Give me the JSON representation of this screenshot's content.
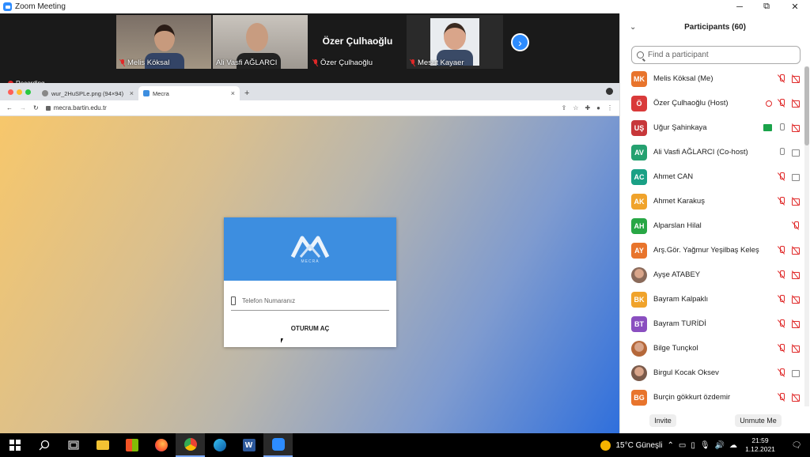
{
  "window": {
    "title": "Zoom Meeting",
    "minimize": "─",
    "restore": "⧉",
    "close": "✕"
  },
  "video_tiles": [
    {
      "name": "Melis Köksal",
      "type": "video",
      "muted": true
    },
    {
      "name": "Ali Vasfi AĞLARCI",
      "type": "video",
      "muted": false
    },
    {
      "name": "Özer Çulhaoğlu",
      "type": "name-only",
      "muted": true,
      "center_name": "Özer Çulhaoğlu"
    },
    {
      "name": "Mesut Kayaer",
      "type": "video",
      "muted": true
    }
  ],
  "next_tiles_icon": "chevron-right-icon",
  "recording": {
    "label": "Recording"
  },
  "browser": {
    "tabs": [
      {
        "label": "wur_2HuSPLe.png (94×94)",
        "active": false
      },
      {
        "label": "Mecra",
        "active": true
      }
    ],
    "new_tab": "+",
    "url": "mecra.bartin.edu.tr",
    "nav": {
      "back": "←",
      "forward": "→",
      "reload": "↻"
    }
  },
  "login": {
    "logo_sub": "MECRA",
    "phone_placeholder": "Telefon Numaranız",
    "button": "OTURUM AÇ"
  },
  "panel": {
    "title": "Participants (60)",
    "search_placeholder": "Find a participant",
    "invite": "Invite",
    "unmute": "Unmute Me",
    "participants": [
      {
        "initials": "MK",
        "name": "Melis Köksal (Me)",
        "color": "#e8742c",
        "icons": [
          "mic-off",
          "cam-off"
        ]
      },
      {
        "initials": "Ö",
        "name": "Özer Çulhaoğlu (Host)",
        "color": "#d93a3a",
        "icons": [
          "rec",
          "mic-off",
          "cam-off"
        ]
      },
      {
        "initials": "UŞ",
        "name": "Uğur Şahinkaya",
        "color": "#c7373a",
        "icons": [
          "share",
          "mic",
          "cam-off"
        ]
      },
      {
        "initials": "AV",
        "name": "Ali Vasfi AĞLARCI (Co-host)",
        "color": "#25a170",
        "icons": [
          "mic",
          "cam"
        ]
      },
      {
        "initials": "AC",
        "name": "Ahmet CAN",
        "color": "#1aa085",
        "icons": [
          "mic-off",
          "cam"
        ]
      },
      {
        "initials": "AK",
        "name": "Ahmet Karakuş",
        "color": "#f0a32b",
        "icons": [
          "mic-off",
          "cam-off"
        ]
      },
      {
        "initials": "AH",
        "name": "Alparslan Hilal",
        "color": "#28a745",
        "icons": [
          "mic-off"
        ]
      },
      {
        "initials": "AY",
        "name": "Arş.Gör. Yağmur Yeşilbaş Keleş",
        "color": "#e8742c",
        "icons": [
          "mic-off",
          "cam-off"
        ]
      },
      {
        "initials": "",
        "name": "Ayşe ATABEY",
        "color": "#8a6a5a",
        "photo": true,
        "icons": [
          "mic-off",
          "cam-off"
        ]
      },
      {
        "initials": "BK",
        "name": "Bayram Kalpaklı",
        "color": "#f0a32b",
        "icons": [
          "mic-off",
          "cam-off"
        ]
      },
      {
        "initials": "BT",
        "name": "Bayram TURİDİ",
        "color": "#8a4fc0",
        "icons": [
          "mic-off",
          "cam-off"
        ]
      },
      {
        "initials": "",
        "name": "Bilge Tunçkol",
        "color": "#b5683a",
        "photo": true,
        "icons": [
          "mic-off",
          "cam-off"
        ]
      },
      {
        "initials": "",
        "name": "Birgul Kocak Oksev",
        "color": "#7a5a4a",
        "photo": true,
        "icons": [
          "mic-off",
          "cam"
        ]
      },
      {
        "initials": "BG",
        "name": "Burçin gökkurt özdemir",
        "color": "#e8742c",
        "icons": [
          "mic-off",
          "cam-off"
        ]
      }
    ]
  },
  "taskbar": {
    "weather": "15°C  Güneşli",
    "time": "21:59",
    "date": "1.12.2021",
    "apps": [
      "windows-start-icon",
      "search-icon",
      "task-view-icon",
      "file-explorer-icon",
      "store-icon",
      "firefox-icon",
      "chrome-icon",
      "edge-icon",
      "word-icon",
      "zoom-icon"
    ]
  }
}
